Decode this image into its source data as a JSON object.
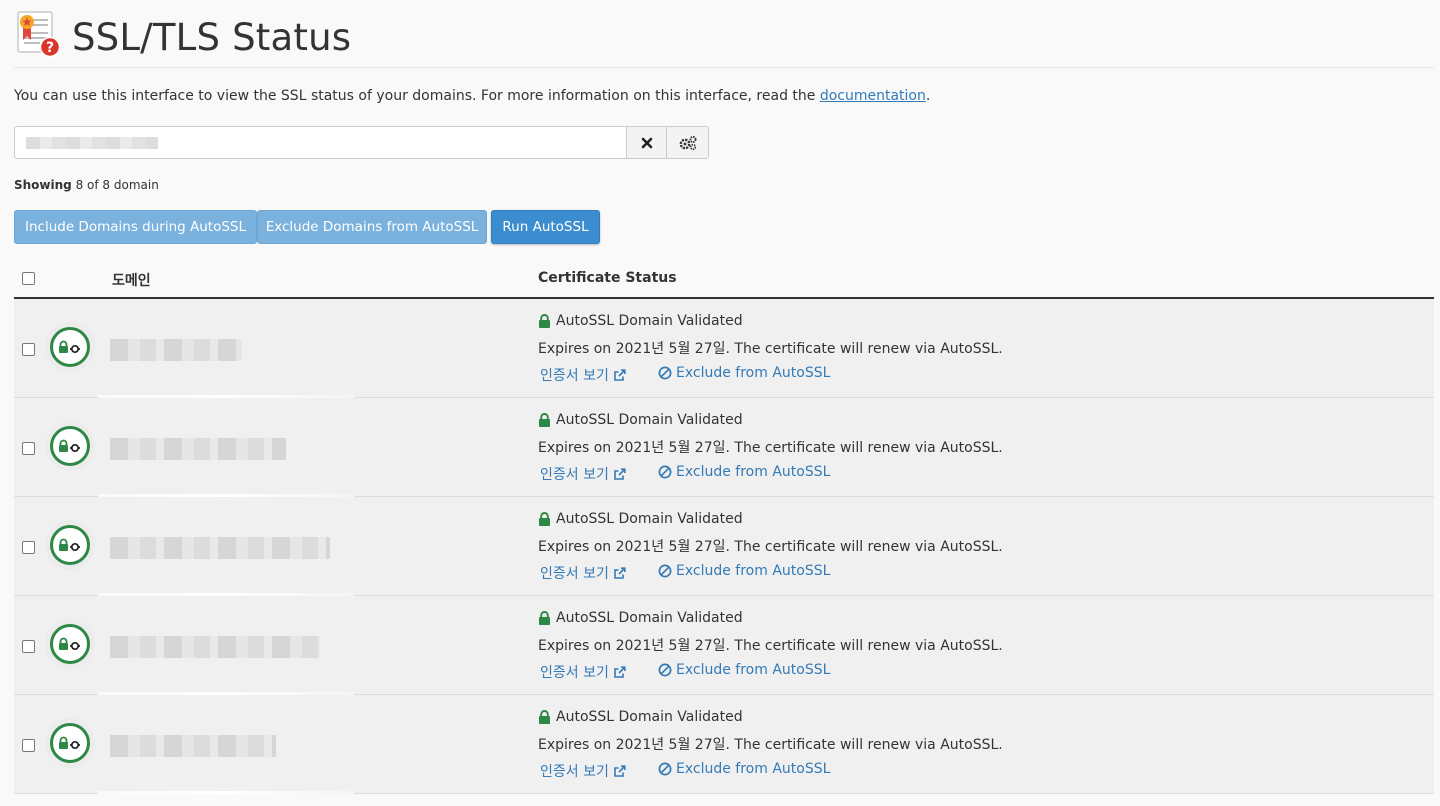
{
  "colors": {
    "link": "#337ab7",
    "success": "#2d8745",
    "primary_button": "#3c8dd0",
    "light_button": "#7ab2dd",
    "badge_red": "#d9352a"
  },
  "header": {
    "title": "SSL/TLS Status",
    "icon": "certificate-question-icon"
  },
  "intro": {
    "text": "You can use this interface to view the SSL status of your domains. For more information on this interface, read the ",
    "link_label": "documentation",
    "suffix": "."
  },
  "search": {
    "value": "",
    "clear_icon": "close-icon",
    "settings_icon": "gears-icon"
  },
  "showing": {
    "label": "Showing",
    "count_text": "8 of 8 domain"
  },
  "actions": {
    "include_label": "Include Domains during AutoSSL",
    "exclude_label": "Exclude Domains from AutoSSL",
    "run_label": "Run AutoSSL"
  },
  "table": {
    "columns": {
      "domain": "도메인",
      "status": "Certificate Status"
    },
    "rows": [
      {
        "status_title": "AutoSSL Domain Validated",
        "expires_text": "Expires on 2021년 5월 27일. The certificate will renew via AutoSSL.",
        "view_label": "인증서 보기",
        "exclude_label": "Exclude from AutoSSL"
      },
      {
        "status_title": "AutoSSL Domain Validated",
        "expires_text": "Expires on 2021년 5월 27일. The certificate will renew via AutoSSL.",
        "view_label": "인증서 보기",
        "exclude_label": "Exclude from AutoSSL"
      },
      {
        "status_title": "AutoSSL Domain Validated",
        "expires_text": "Expires on 2021년 5월 27일. The certificate will renew via AutoSSL.",
        "view_label": "인증서 보기",
        "exclude_label": "Exclude from AutoSSL"
      },
      {
        "status_title": "AutoSSL Domain Validated",
        "expires_text": "Expires on 2021년 5월 27일. The certificate will renew via AutoSSL.",
        "view_label": "인증서 보기",
        "exclude_label": "Exclude from AutoSSL"
      },
      {
        "status_title": "AutoSSL Domain Validated",
        "expires_text": "Expires on 2021년 5월 27일. The certificate will renew via AutoSSL.",
        "view_label": "인증서 보기",
        "exclude_label": "Exclude from AutoSSL"
      }
    ]
  }
}
